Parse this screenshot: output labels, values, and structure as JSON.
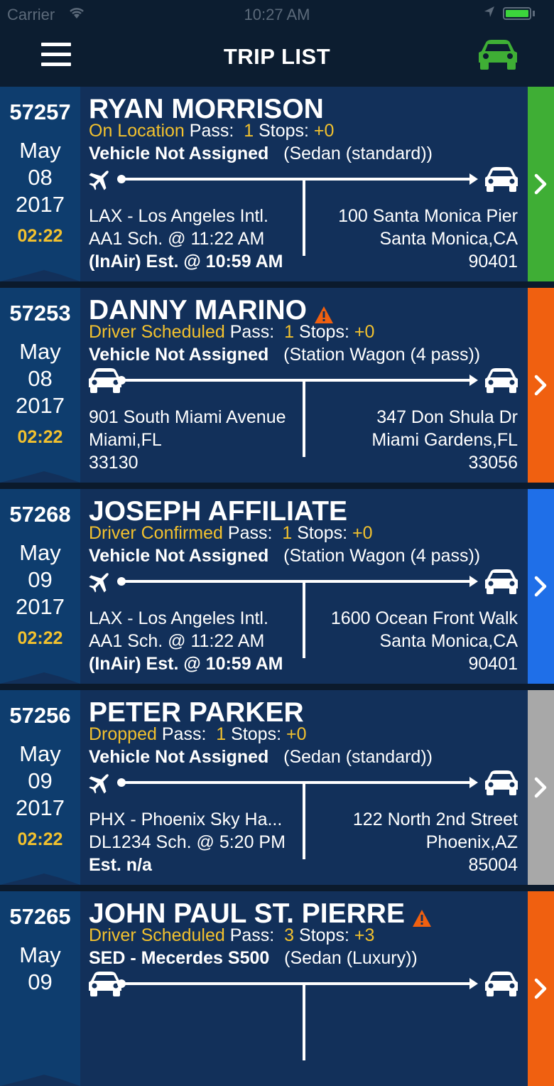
{
  "statusbar": {
    "carrier": "Carrier",
    "time": "10:27 AM"
  },
  "navbar": {
    "title": "TRIP LIST"
  },
  "colors": {
    "green": "#3fae35",
    "orange": "#f06010",
    "blue": "#1f6fe8",
    "gray": "#a8a8a8",
    "yellow": "#f2c12e"
  },
  "trips": [
    {
      "id": "57257",
      "month": "May",
      "day": "08",
      "year": "2017",
      "time": "02:22",
      "name": "RYAN MORRISON",
      "alert": false,
      "status": "On Location",
      "pass_label": "Pass:",
      "pass": "1",
      "stops_label": "Stops:",
      "stops": "+0",
      "vehicle": "Vehicle Not Assigned",
      "vehicle_type": "(Sedan (standard))",
      "from_icon": "plane-icon",
      "from": [
        "LAX  - Los Angeles Intl.",
        "AA1 Sch. @ 11:22 AM",
        "(InAir) Est. @ 10:59 AM"
      ],
      "to": [
        "100 Santa Monica Pier",
        "Santa Monica,CA",
        "90401"
      ],
      "status_color": "green"
    },
    {
      "id": "57253",
      "month": "May",
      "day": "08",
      "year": "2017",
      "time": "02:22",
      "name": "DANNY MARINO",
      "alert": true,
      "status": "Driver Scheduled",
      "pass_label": "Pass:",
      "pass": "1",
      "stops_label": "Stops:",
      "stops": "+0",
      "vehicle": "Vehicle Not Assigned",
      "vehicle_type": "(Station Wagon (4 pass))",
      "from_icon": "car-icon",
      "from": [
        "901 South Miami Avenue",
        "Miami,FL",
        "33130"
      ],
      "to": [
        "347 Don Shula Dr",
        "Miami Gardens,FL",
        "33056"
      ],
      "status_color": "orange"
    },
    {
      "id": "57268",
      "month": "May",
      "day": "09",
      "year": "2017",
      "time": "02:22",
      "name": "JOSEPH AFFILIATE",
      "alert": false,
      "status": "Driver Confirmed",
      "pass_label": "Pass:",
      "pass": "1",
      "stops_label": "Stops:",
      "stops": "+0",
      "vehicle": "Vehicle Not Assigned",
      "vehicle_type": "(Station Wagon (4 pass))",
      "from_icon": "plane-icon",
      "from": [
        "LAX  - Los Angeles Intl.",
        "AA1 Sch. @ 11:22 AM",
        "(InAir) Est. @ 10:59 AM"
      ],
      "to": [
        "1600 Ocean Front Walk",
        "Santa Monica,CA",
        "90401"
      ],
      "status_color": "blue"
    },
    {
      "id": "57256",
      "month": "May",
      "day": "09",
      "year": "2017",
      "time": "02:22",
      "name": "PETER PARKER",
      "alert": false,
      "status": "Dropped",
      "pass_label": "Pass:",
      "pass": "1",
      "stops_label": "Stops:",
      "stops": "+0",
      "vehicle": "Vehicle Not Assigned",
      "vehicle_type": "(Sedan (standard))",
      "from_icon": "plane-icon",
      "from": [
        "PHX  - Phoenix Sky Ha...",
        "DL1234 Sch. @ 5:20 PM",
        "Est. n/a"
      ],
      "to": [
        "122 North 2nd Street",
        "Phoenix,AZ",
        "85004"
      ],
      "status_color": "gray"
    },
    {
      "id": "57265",
      "month": "May",
      "day": "09",
      "year": "",
      "time": "",
      "name": "JOHN PAUL ST. PIERRE",
      "alert": true,
      "status": "Driver Scheduled",
      "pass_label": "Pass:",
      "pass": "3",
      "stops_label": "Stops:",
      "stops": "+3",
      "vehicle": "SED - Mecerdes S500",
      "vehicle_type": "(Sedan (Luxury))",
      "from_icon": "car-icon",
      "from": [
        "",
        "",
        ""
      ],
      "to": [
        "",
        "",
        ""
      ],
      "status_color": "orange"
    }
  ]
}
